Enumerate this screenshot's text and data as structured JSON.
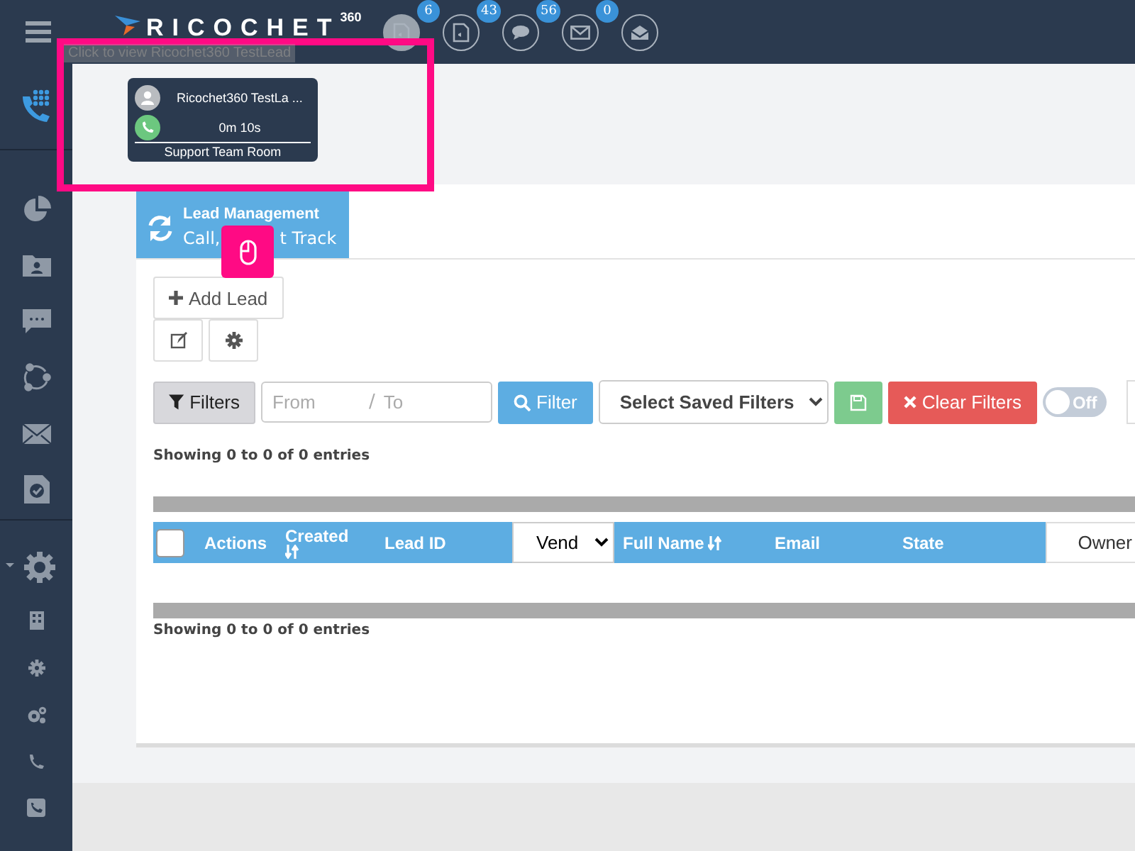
{
  "header": {
    "logo": "RICOCHET",
    "logo_sup": "360",
    "notifications": [
      {
        "kind": "phone-doc",
        "count": "6",
        "highlighted": true
      },
      {
        "kind": "audio-doc",
        "count": "43",
        "highlighted": false
      },
      {
        "kind": "chat",
        "count": "56",
        "highlighted": false
      },
      {
        "kind": "mail",
        "count": "0",
        "highlighted": false
      },
      {
        "kind": "mail-open",
        "highlighted": false
      }
    ]
  },
  "tooltip": "Click to view Ricochet360 TestLead",
  "call_card": {
    "name": "Ricochet360 TestLa ...",
    "duration": "0m 10s",
    "room": "Support Team Room"
  },
  "sidebar": {
    "top": [
      {
        "kind": "dialpad",
        "selected": true
      }
    ],
    "middle": [
      {
        "kind": "pie",
        "selected": false
      },
      {
        "kind": "contacts",
        "selected": false
      },
      {
        "kind": "chat",
        "selected": false
      },
      {
        "kind": "share",
        "selected": false
      },
      {
        "kind": "mail",
        "selected": false
      },
      {
        "kind": "check",
        "selected": false
      }
    ],
    "bottom": [
      {
        "kind": "gear-caret",
        "selected": false
      },
      {
        "kind": "building",
        "selected": false
      },
      {
        "kind": "gear",
        "selected": false
      },
      {
        "kind": "gears",
        "selected": false
      },
      {
        "kind": "phone",
        "selected": false
      },
      {
        "kind": "phone-square",
        "selected": false
      }
    ]
  },
  "tile": {
    "title": "Lead Management",
    "subtitle_parts": [
      "Call,",
      "t Track"
    ]
  },
  "toolbar": {
    "add_lead": "Add Lead"
  },
  "filters": {
    "button": "Filters",
    "from_placeholder": "From",
    "separator": "/",
    "to_placeholder": "To",
    "filter_button": "Filter",
    "saved_select": "Select Saved Filters",
    "clear": "Clear Filters",
    "toggle": {
      "label": "Off",
      "on": false
    }
  },
  "info_top": "Showing 0 to 0 of 0 entries",
  "table": {
    "columns": [
      {
        "kind": "checkbox",
        "checked": false
      },
      {
        "kind": "text",
        "label": "Actions"
      },
      {
        "kind": "sort",
        "label": "Created"
      },
      {
        "kind": "text",
        "label": "Lead ID"
      },
      {
        "kind": "select",
        "label": "Vend"
      },
      {
        "kind": "sort",
        "label": "Full Name"
      },
      {
        "kind": "text",
        "label": "Email"
      },
      {
        "kind": "text",
        "label": "State"
      },
      {
        "kind": "plain",
        "label": "Owner"
      }
    ]
  },
  "info_bottom": "Showing 0 to 0 of 0 entries"
}
